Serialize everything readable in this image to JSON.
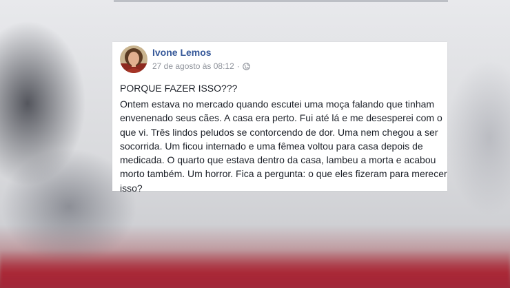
{
  "post": {
    "author": "Ivone Lemos",
    "timestamp": "27 de agosto às 08:12",
    "separator": "·",
    "privacy_icon": "globe-icon",
    "headline": "PORQUE FAZER ISSO???",
    "body_lines": [
      "Ontem estava no mercado quando escutei uma moça falando que tinham",
      "envenenado seus cães. A casa era perto. Fui até lá e me desesperei com o",
      "que vi. Três lindos peludos se contorcendo de dor. Uma nem chegou a ser",
      "socorrida. Um ficou internado e uma fêmea voltou para casa depois de",
      "medicada. O quarto que estava dentro da casa, lambeu a morta e acabou",
      "morto também. Um horror. Fica a pergunta: o que eles fizeram para merecer",
      "isso?"
    ]
  },
  "colors": {
    "author_link": "#365899",
    "meta_text": "#90949c",
    "body_text": "#1d2129"
  }
}
